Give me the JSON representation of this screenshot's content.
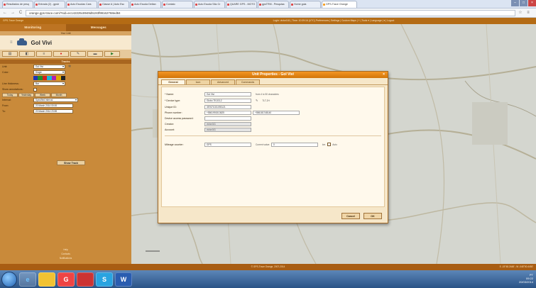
{
  "browser": {
    "tabs": [
      {
        "label": "Resultados de pesq"
      },
      {
        "label": "Entrada (2) - gpstr"
      },
      {
        "label": "Auto Escolas Cars"
      },
      {
        "label": "Classe A | Auto Esc"
      },
      {
        "label": "Auto Escola Deltan"
      },
      {
        "label": "Contato"
      },
      {
        "label": "Auto Escola São Cr"
      },
      {
        "label": "QUARE GPS - MOTO"
      },
      {
        "label": "gpsTRM - Pesquisa"
      },
      {
        "label": "Home goia"
      },
      {
        "label": "GPS-Trace Orange"
      }
    ],
    "back": "←",
    "forward": "→",
    "reload": "C",
    "url": "orange.gps-trace.com/?sid=ec142225c8949d5193f99162768ed84"
  },
  "app": {
    "brand": "GPS-Trace Orange",
    "top_links": "Login: victor161 | Time: 10:39:16 (UTC) Preferences | Settings | Custom Maps | + | Tools ▾ | Language | ▾ | Logout",
    "status": "© GPS-Trace Orange, 2007-2014",
    "coords": "S -15°48.2448' ; W -048°00.4450'"
  },
  "sidebar": {
    "tab_monitoring": "Monitoring",
    "tab_messages": "Messages",
    "unit_header": "Your Unit",
    "unit_name": "Gol Vivi",
    "tracks_title": "Tracks",
    "unit_label": "Unit:",
    "unit_value": "Gol Vivi",
    "color_label": "Color:",
    "color_value": "Single",
    "line_thickness_label": "Line thickness:",
    "line_thickness_value": "Bar",
    "annotations_label": "Show annotations:",
    "periods": [
      "Today",
      "Yesterday",
      "Week",
      "Month"
    ],
    "interval_label": "Interval:",
    "interval_value": "Specified interval",
    "from_label": "From:",
    "from_value": "20 March 2014 00:00",
    "to_label": "To:",
    "to_value": "20 March 2014 23:59",
    "show_track": "Show Track",
    "footer_lines": [
      "Help",
      "Contacts",
      "Notifications"
    ]
  },
  "dialog": {
    "title": "Unit Properties - Gol Vivi",
    "tabs": [
      "General",
      "Icon",
      "Advanced",
      "Commands"
    ],
    "name_label": "* Name:",
    "name_value": "Gol Vivi",
    "name_note": "from 4 to 50 characters",
    "device_type_label": "* Device type:",
    "device_type_value": "Globo TK103-2",
    "device_type_note": "TLT-2H",
    "unique_id_label": "Unique ID:",
    "unique_id_value": "357671031093121",
    "phone_label": "Phone number:",
    "phone_value": "+5561991513625",
    "phone2_value": "+556181748140",
    "password_label": "Device access password:",
    "creator_label": "Creator:",
    "creator_value": "victor161",
    "account_label": "Account:",
    "account_value": "victor161",
    "mileage_label": "Mileage counter:",
    "mileage_value": "GPS",
    "current_value_label": "Current value:",
    "current_value": "0",
    "km_label": "km",
    "auto_label": "Auto",
    "cancel": "Cancel",
    "ok": "OK"
  },
  "taskbar": {
    "icons": [
      "e",
      "",
      "G",
      "",
      "S",
      "W"
    ],
    "time": "09:22",
    "date": "20/03/2014",
    "lang": "PT"
  },
  "colors": {
    "accent": "#f49623",
    "sidebar": "#c98a3a",
    "topbar": "#b46b14"
  }
}
